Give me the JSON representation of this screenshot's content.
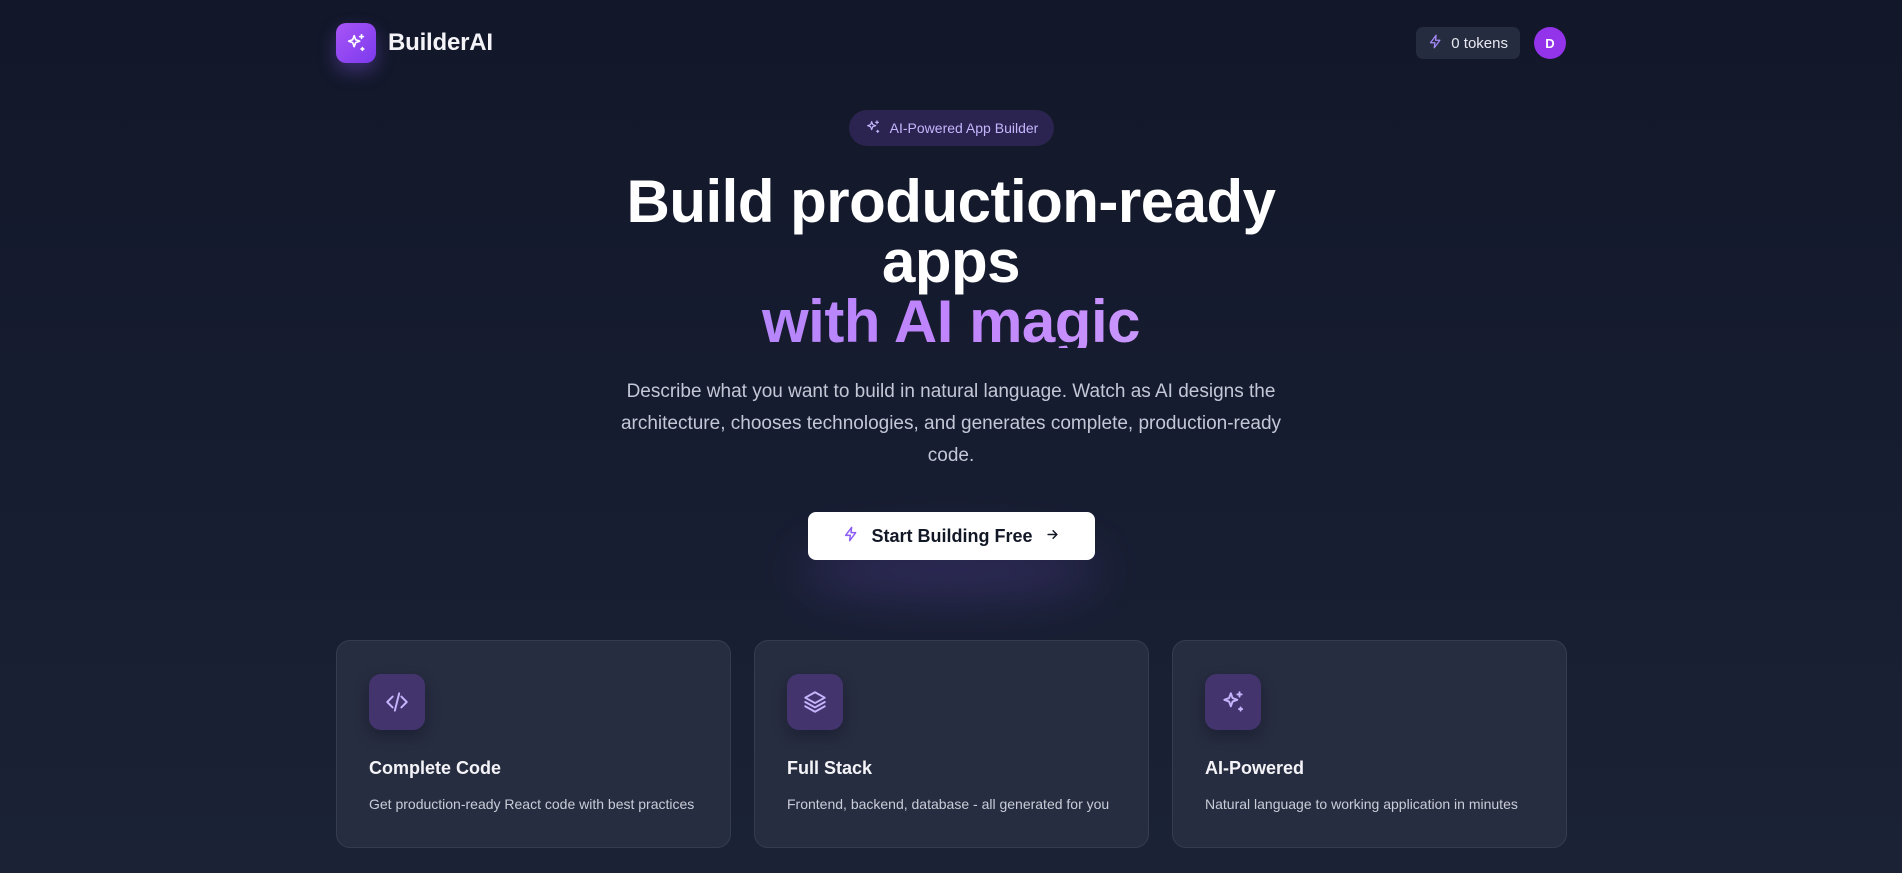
{
  "header": {
    "brand_name": "BuilderAI",
    "tokens_label": "0 tokens",
    "avatar_initial": "D"
  },
  "hero": {
    "badge": "AI-Powered App Builder",
    "title_line1": "Build production-ready",
    "title_line2": "apps",
    "title_accent": "with AI magic",
    "subtitle": "Describe what you want to build in natural language. Watch as AI designs the architecture, chooses technologies, and generates complete, production-ready code.",
    "cta_label": "Start Building Free"
  },
  "features": [
    {
      "icon": "code-icon",
      "title": "Complete Code",
      "description": "Get production-ready React code with best practices"
    },
    {
      "icon": "layers-icon",
      "title": "Full Stack",
      "description": "Frontend, backend, database - all generated for you"
    },
    {
      "icon": "sparkles-icon",
      "title": "AI-Powered",
      "description": "Natural language to working application in minutes"
    }
  ],
  "colors": {
    "background": "#141a2c",
    "accent": "#a855f7",
    "card": "#272d40"
  }
}
